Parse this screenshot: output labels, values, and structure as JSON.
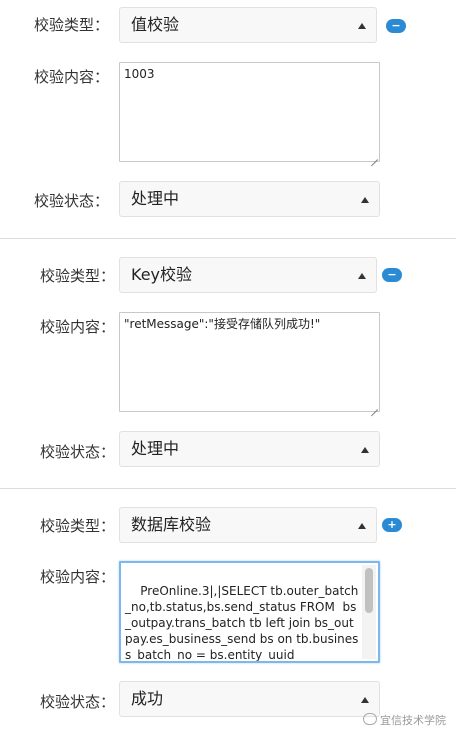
{
  "labels": {
    "type": "校验类型：",
    "content": "校验内容：",
    "status": "校验状态："
  },
  "rules": [
    {
      "type_value": "值校验",
      "content_value": "1003",
      "status_value": "处理中",
      "action": "−"
    },
    {
      "type_value": "Key校验",
      "content_value": "\"retMessage\":\"接受存储队列成功!\"",
      "status_value": "处理中",
      "action": "−"
    },
    {
      "type_value": "数据库校验",
      "content_value": "PreOnline.3|,|SELECT tb.outer_batch_no,tb.status,bs.send_status FROM  bs_outpay.trans_batch tb left join bs_outpay.es_business_send bs on tb.business_batch_no = bs.entity_uuid",
      "status_value": "成功",
      "action": "+"
    }
  ],
  "watermark": "宜信技术学院",
  "colors": {
    "accent": "#2a8bd4",
    "focus_border": "#7fb6ec",
    "divider": "#dcdcdc"
  }
}
